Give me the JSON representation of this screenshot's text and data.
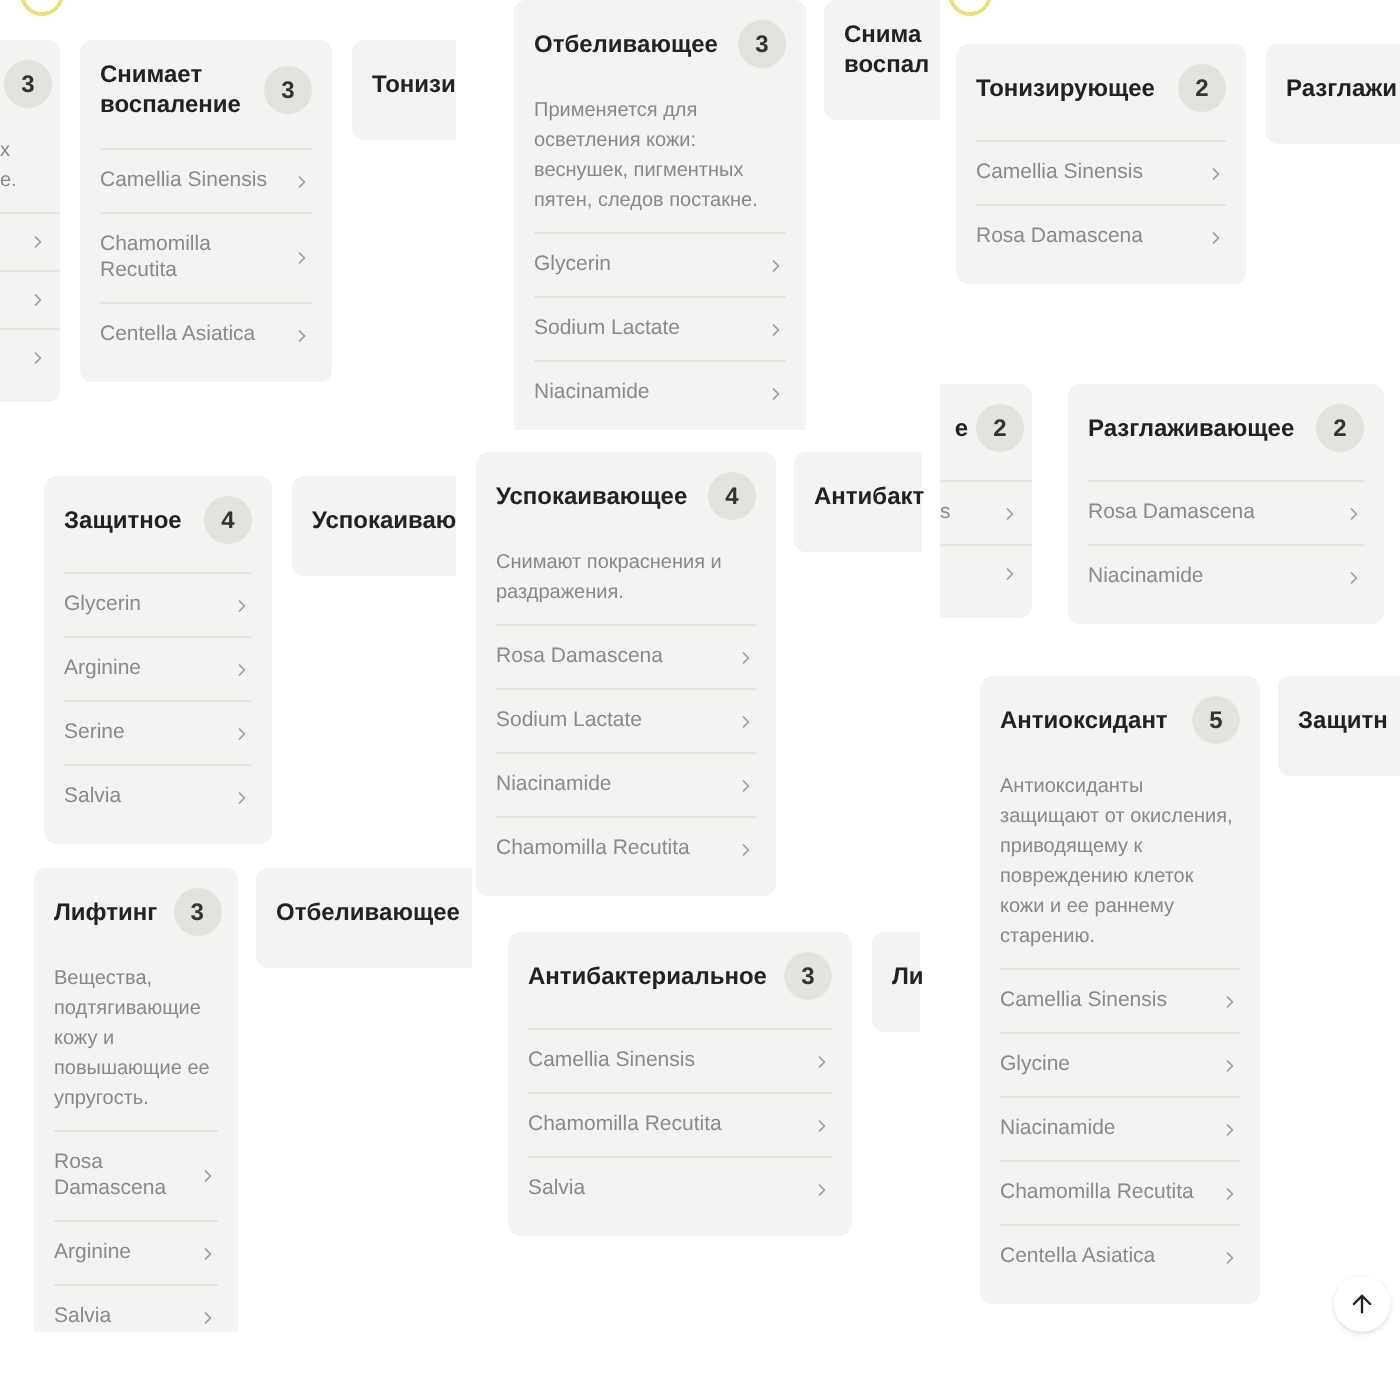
{
  "tiles": [
    {
      "ring": true,
      "cards": [
        {
          "kind": "edge",
          "count": "3",
          "description": "х\nе.",
          "items": [
            {
              "chevron": true
            },
            {
              "chevron": true
            },
            {
              "chevron": true
            }
          ]
        },
        {
          "kind": "full",
          "title": "Снимает воспаление",
          "count": "3",
          "items": [
            {
              "name": "Camellia Sinensis"
            },
            {
              "name": "Chamomilla Recutita"
            },
            {
              "name": "Centella Asiatica"
            }
          ]
        },
        {
          "kind": "stub",
          "title": "Тонизи"
        }
      ]
    },
    {
      "cards": [
        {
          "kind": "full",
          "title": "Отбеливающее",
          "count": "3",
          "description": "Применяется для осветления кожи: веснушек, пигментных пятен, следов постакне.",
          "items": [
            {
              "name": "Glycerin"
            },
            {
              "name": "Sodium Lactate"
            },
            {
              "name": "Niacinamide"
            }
          ]
        },
        {
          "kind": "stub",
          "title": "Снима воспал"
        }
      ]
    },
    {
      "ring": true,
      "cards": [
        {
          "kind": "full",
          "title": "Тонизирующее",
          "count": "2",
          "items": [
            {
              "name": "Camellia Sinensis"
            },
            {
              "name": "Rosa Damascena"
            }
          ]
        },
        {
          "kind": "stub",
          "title": "Разглажи"
        }
      ]
    },
    {
      "cards": [
        {
          "kind": "edge",
          "title": "е",
          "count": "2",
          "items": [
            {
              "name": "s",
              "chevron": true
            },
            {
              "chevron": true
            }
          ]
        },
        {
          "kind": "full",
          "title": "Разглаживающее",
          "count": "2",
          "items": [
            {
              "name": "Rosa Damascena"
            },
            {
              "name": "Niacinamide"
            }
          ]
        }
      ]
    },
    {
      "cards": [
        {
          "kind": "full",
          "title": "Защитное",
          "count": "4",
          "items": [
            {
              "name": "Glycerin"
            },
            {
              "name": "Arginine"
            },
            {
              "name": "Serine"
            },
            {
              "name": "Salvia"
            }
          ]
        },
        {
          "kind": "stub",
          "title": "Успокаиваю"
        }
      ]
    },
    {
      "cards": [
        {
          "kind": "full",
          "title": "Лифтинг",
          "count": "3",
          "description": "Вещества, подтягивающие кожу и повышающие ее упругость.",
          "items": [
            {
              "name": "Rosa Damascena"
            },
            {
              "name": "Arginine"
            },
            {
              "name": "Salvia"
            }
          ]
        },
        {
          "kind": "stub",
          "title": "Отбеливающее"
        }
      ]
    },
    {
      "cards": [
        {
          "kind": "full",
          "title": "Успокаивающее",
          "count": "4",
          "description": "Снимают покраснения и раздражения.",
          "items": [
            {
              "name": "Rosa Damascena"
            },
            {
              "name": "Sodium Lactate"
            },
            {
              "name": "Niacinamide"
            },
            {
              "name": "Chamomilla Recutita"
            }
          ]
        },
        {
          "kind": "stub",
          "title": "Антибакт"
        }
      ]
    },
    {
      "cards": [
        {
          "kind": "full",
          "title": "Антибактериальное",
          "count": "3",
          "items": [
            {
              "name": "Camellia Sinensis"
            },
            {
              "name": "Chamomilla Recutita"
            },
            {
              "name": "Salvia"
            }
          ]
        },
        {
          "kind": "stub",
          "title": "Ли"
        }
      ]
    },
    {
      "cards": [
        {
          "kind": "full",
          "title": "Антиоксидант",
          "count": "5",
          "description": "Антиоксиданты защищают от окисления, приводящему к повреждению клеток кожи и ее раннему старению.",
          "items": [
            {
              "name": "Camellia Sinensis"
            },
            {
              "name": "Glycine"
            },
            {
              "name": "Niacinamide"
            },
            {
              "name": "Chamomilla Recutita"
            },
            {
              "name": "Centella Asiatica"
            }
          ]
        },
        {
          "kind": "stub",
          "title": "Защитн"
        }
      ]
    }
  ],
  "scroll_top_button": true
}
